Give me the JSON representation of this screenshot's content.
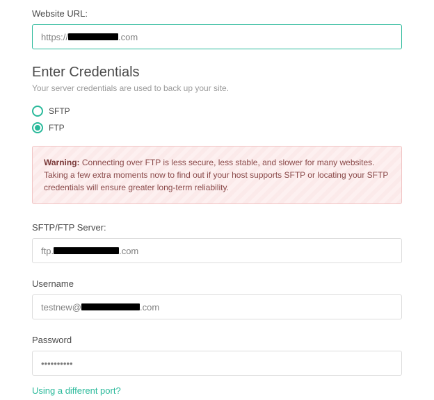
{
  "url_field": {
    "label": "Website URL:",
    "prefix": "https://",
    "redact_width": 72,
    "suffix": ".com"
  },
  "credentials": {
    "title": "Enter Credentials",
    "subtitle": "Your server credentials are used to back up your site."
  },
  "protocol": {
    "options": [
      {
        "label": "SFTP",
        "selected": false
      },
      {
        "label": "FTP",
        "selected": true
      }
    ]
  },
  "warning": {
    "prefix": "Warning:",
    "body": " Connecting over FTP is less secure, less stable, and slower for many websites. Taking a few extra moments now to find out if your host supports SFTP or locating your SFTP credentials will ensure greater long-term reliability."
  },
  "server_field": {
    "label": "SFTP/FTP Server:",
    "prefix": "ftp.",
    "redact_width": 94,
    "suffix": ".com"
  },
  "username_field": {
    "label": "Username",
    "prefix": "testnew@",
    "redact_width": 84,
    "suffix": ".com"
  },
  "password_field": {
    "label": "Password",
    "value": "••••••••••"
  },
  "port_link": "Using a different port?"
}
